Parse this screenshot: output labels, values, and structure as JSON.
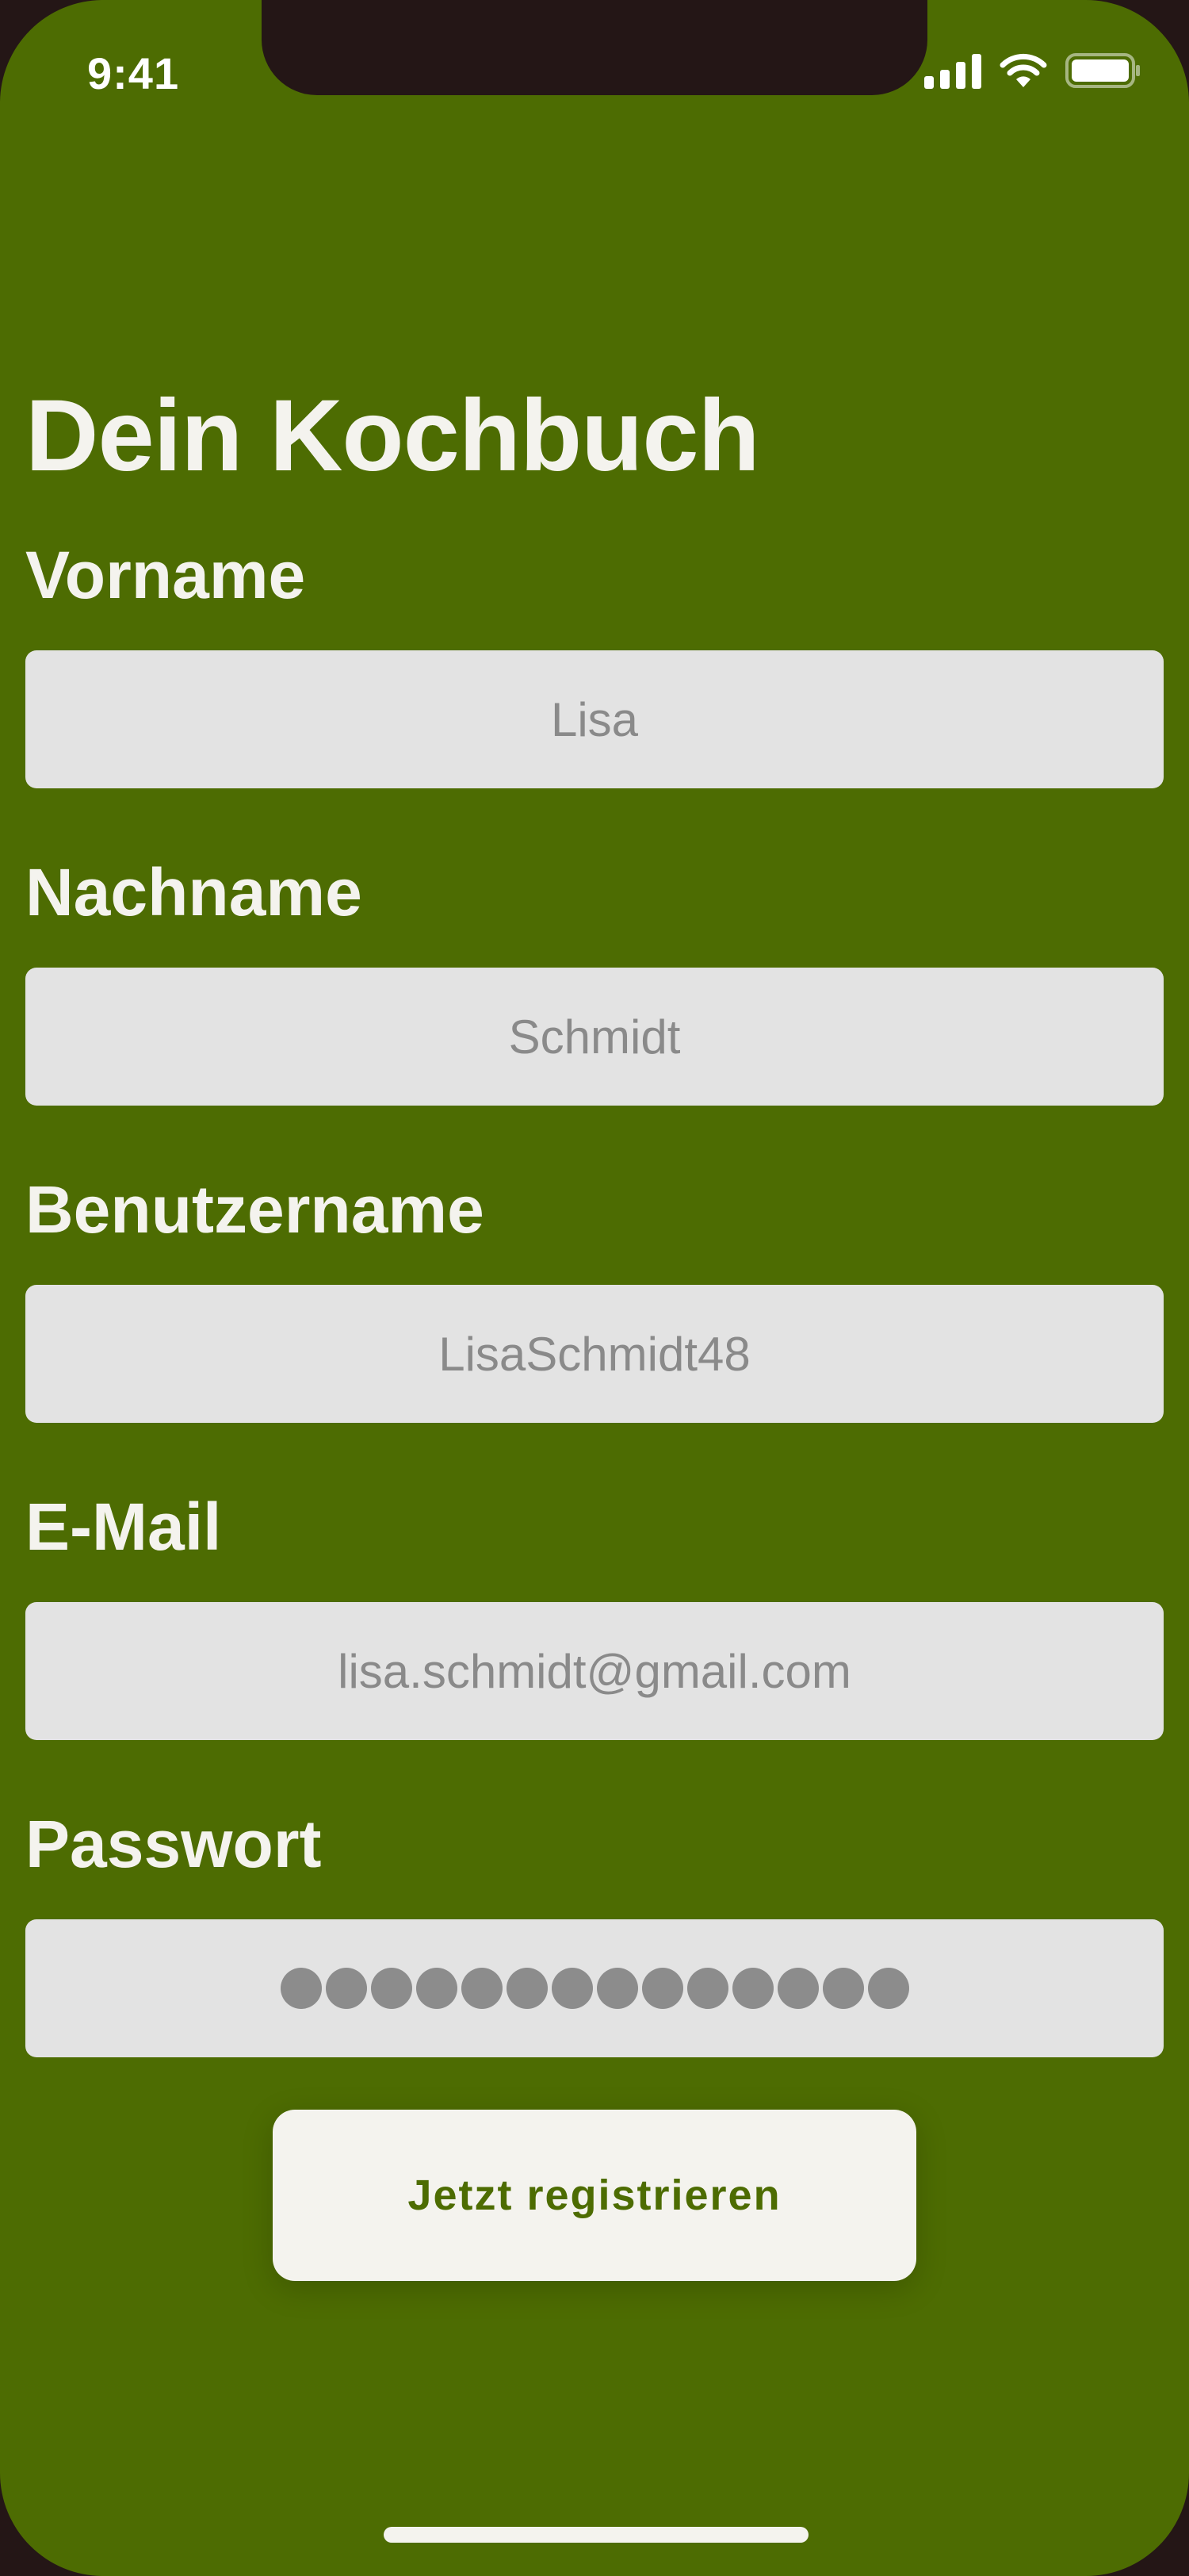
{
  "status_bar": {
    "time": "9:41",
    "icons": [
      "signal-icon",
      "wifi-icon",
      "battery-icon"
    ]
  },
  "app": {
    "title": "Dein Kochbuch"
  },
  "form": {
    "first_name": {
      "label": "Vorname",
      "value": "Lisa"
    },
    "last_name": {
      "label": "Nachname",
      "value": "Schmidt"
    },
    "username": {
      "label": "Benutzername",
      "value": "LisaSchmidt48"
    },
    "email": {
      "label": "E-Mail",
      "value": "lisa.schmidt@gmail.com"
    },
    "password": {
      "label": "Passwort",
      "masked_length": 14
    },
    "submit_label": "Jetzt registrieren"
  },
  "colors": {
    "background": "#4d6c02",
    "text_light": "#f4f3ee",
    "input_bg": "#e3e3e3",
    "input_text": "#8a8a8a",
    "button_bg": "#f4f3ee",
    "button_text": "#4d6c02"
  }
}
